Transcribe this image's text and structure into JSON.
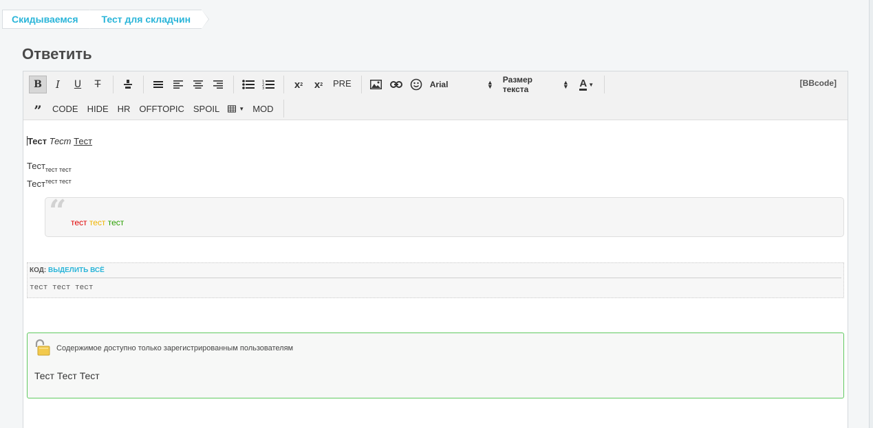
{
  "breadcrumb": {
    "items": [
      "Скидываемся",
      "Тест для складчин"
    ]
  },
  "page_title": "Ответить",
  "toolbar": {
    "row1": {
      "bold": "B",
      "italic": "I",
      "underline": "U",
      "strike": "T",
      "subscript_label": "x",
      "subscript_mark": "2",
      "superscript_label": "x",
      "superscript_mark": "2",
      "pre": "PRE",
      "font": "Arial",
      "size": "Размер текста",
      "color": "A",
      "bbcode": "[BBcode]"
    },
    "row2": {
      "quote": "”",
      "code": "CODE",
      "hide": "HIDE",
      "hr": "HR",
      "offtopic": "OFFTOPIC",
      "spoil": "SPOIL",
      "mod": "MOD"
    }
  },
  "content": {
    "line1": {
      "bold": "Тест",
      "italic": "Тест",
      "underline": "Тест"
    },
    "line2": {
      "main": "Тест",
      "sub": "тест тест"
    },
    "line3": {
      "main": "Тест",
      "sup": "тест тест"
    },
    "quote": {
      "red": "тест",
      "yellow": "тест",
      "green": "тест"
    },
    "code": {
      "label": "КОД:",
      "select_all": "ВЫДЕЛИТЬ ВСЁ",
      "body": "тест тест тест"
    },
    "hide": {
      "notice": "Содержимое доступно только зарегистрированным пользователям",
      "text": "Тест Тест Тест"
    }
  },
  "colors": {
    "accent": "#2ab5d9",
    "quote_red": "#e00000",
    "quote_yellow": "#f0b400",
    "quote_green": "#2aa000",
    "hide_border": "#5fc95f"
  }
}
